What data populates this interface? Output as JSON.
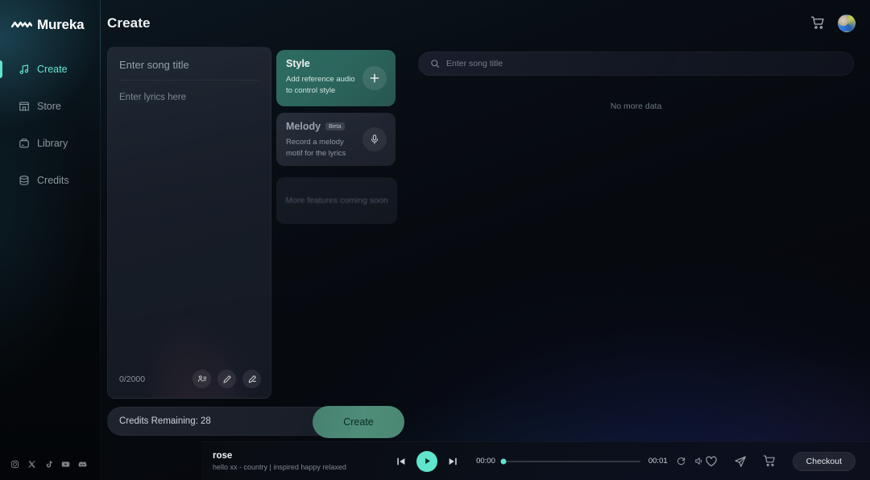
{
  "brand": {
    "name": "Mureka",
    "logo_icon": "waveform-logo-icon"
  },
  "sidebar": {
    "items": [
      {
        "label": "Create",
        "icon": "music-note-icon",
        "active": true
      },
      {
        "label": "Store",
        "icon": "store-icon",
        "active": false
      },
      {
        "label": "Library",
        "icon": "library-icon",
        "active": false
      },
      {
        "label": "Credits",
        "icon": "database-icon",
        "active": false
      }
    ],
    "socials": [
      {
        "name": "instagram-icon"
      },
      {
        "name": "x-twitter-icon"
      },
      {
        "name": "tiktok-icon"
      },
      {
        "name": "youtube-icon"
      },
      {
        "name": "discord-icon"
      }
    ]
  },
  "header": {
    "title": "Create",
    "cart_icon": "cart-icon",
    "avatar_label": "User avatar"
  },
  "editor": {
    "title_placeholder": "Enter song title",
    "title_value": "",
    "lyrics_placeholder": "Enter lyrics here",
    "lyrics_value": "",
    "char_count": "0/2000",
    "tools": [
      {
        "name": "lyrics-template-icon"
      },
      {
        "name": "edit-pencil-icon"
      },
      {
        "name": "write-lyrics-icon"
      }
    ]
  },
  "credits": {
    "label": "Credits Remaining: 28",
    "create_label": "Create"
  },
  "cards": [
    {
      "title": "Style",
      "badge": "",
      "desc": "Add reference audio\nto control style",
      "desc_line1": "Add reference audio",
      "desc_line2": "to control style",
      "action_icon": "plus-icon"
    },
    {
      "title": "Melody",
      "badge": "Beta",
      "desc_line1": "Record a melody",
      "desc_line2": "motif for the lyrics",
      "action_icon": "microphone-icon"
    }
  ],
  "coming_soon": {
    "label": "More features coming soon"
  },
  "library": {
    "search_placeholder": "Enter song title",
    "search_value": "",
    "search_icon": "search-icon",
    "empty_text": "No more data"
  },
  "player": {
    "track_title": "rose",
    "track_subtitle": "hello xx - country | inspired happy relaxed",
    "current_time": "00:00",
    "total_time": "00:01",
    "progress_percent": 0,
    "prev_icon": "skip-previous-icon",
    "play_icon": "play-icon",
    "next_icon": "skip-next-icon",
    "repeat_icon": "repeat-icon",
    "volume_icon": "volume-icon",
    "like_icon": "heart-icon",
    "share_icon": "send-icon",
    "cart_icon": "cart-icon",
    "checkout_label": "Checkout"
  },
  "colors": {
    "accent": "#5fe5cd",
    "style_card": "#2d6b60",
    "create_button": "#4e8d79",
    "background": "#06090e"
  }
}
